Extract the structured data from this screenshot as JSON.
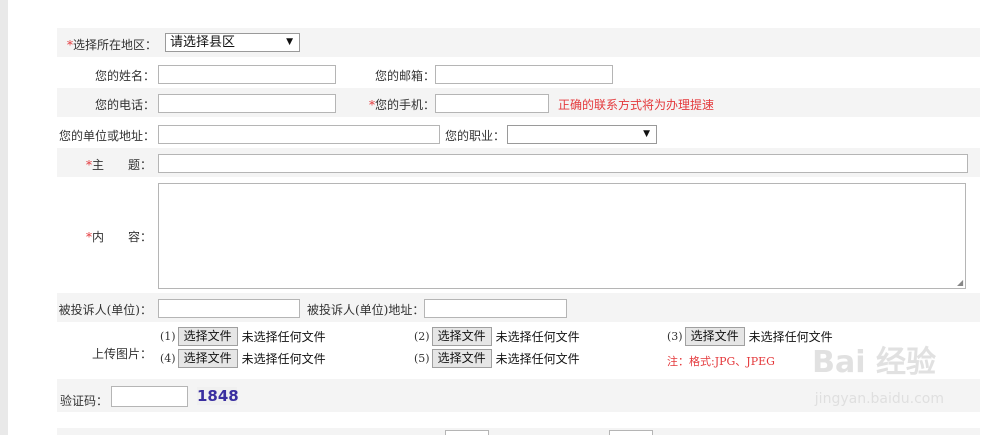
{
  "region": {
    "label_star": "*",
    "label": "选择所在地区：",
    "selected": "请选择县区"
  },
  "name": {
    "label": "您的姓名：",
    "value": ""
  },
  "email": {
    "label": "您的邮箱：",
    "value": ""
  },
  "phone": {
    "label": "您的电话：",
    "value": ""
  },
  "mobile": {
    "label_star": "*",
    "label": "您的手机：",
    "value": "",
    "tip": "正确的联系方式将为办理提速"
  },
  "company": {
    "label": "您的单位或地址：",
    "value": ""
  },
  "job": {
    "label": "您的职业：",
    "selected": ""
  },
  "subject": {
    "label_star": "*",
    "label": "主　　题：",
    "value": ""
  },
  "content": {
    "label_star": "*",
    "label": "内　　容：",
    "value": ""
  },
  "respondent": {
    "label": "被投诉人(单位)：",
    "value": ""
  },
  "respondent_address": {
    "label": "被投诉人(单位)地址：",
    "value": ""
  },
  "upload": {
    "label": "上传图片：",
    "button_label": "选择文件",
    "no_file_text": "未选择任何文件",
    "slots": [
      "(1)",
      "(2)",
      "(3)",
      "(4)",
      "(5)"
    ],
    "note": "注：格式:JPG、JPEG"
  },
  "captcha": {
    "label": "验证码：",
    "value": "",
    "code": "1848"
  },
  "watermark": {
    "logo": "Bai 经验",
    "url": "jingyan.baidu.com"
  },
  "colors": {
    "required": "#e4393c",
    "row_bg": "#f4f4f4",
    "captcha_text": "#3a2fa0"
  }
}
